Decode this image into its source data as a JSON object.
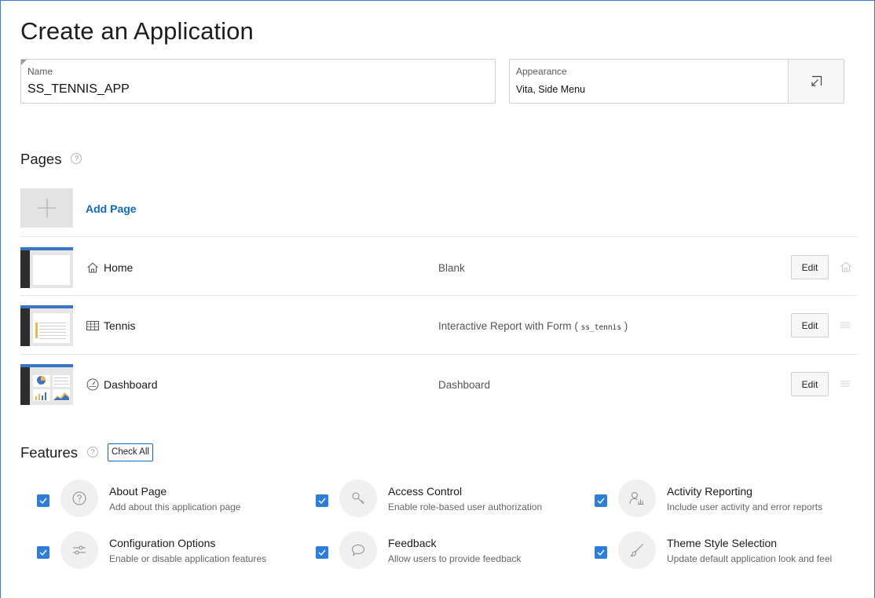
{
  "page": {
    "title": "Create an Application"
  },
  "name_field": {
    "label": "Name",
    "value": "SS_TENNIS_APP"
  },
  "appearance_field": {
    "label": "Appearance",
    "value": "Vita, Side Menu",
    "button_icon": "external-select-icon"
  },
  "pages_section": {
    "title": "Pages",
    "help": "?",
    "add_label": "Add Page",
    "edit_label": "Edit",
    "rows": [
      {
        "name": "Home",
        "icon": "home-icon",
        "type": "Blank",
        "table": "",
        "trail_icon": "home-icon"
      },
      {
        "name": "Tennis",
        "icon": "table-icon",
        "type": "Interactive Report with Form",
        "table": "ss_tennis",
        "trail_icon": "drag-handle-icon"
      },
      {
        "name": "Dashboard",
        "icon": "gauge-icon",
        "type": "Dashboard",
        "table": "",
        "trail_icon": "drag-handle-icon"
      }
    ]
  },
  "features_section": {
    "title": "Features",
    "help": "?",
    "check_all_label": "Check All",
    "items": [
      {
        "title": "About Page",
        "desc": "Add about this application page",
        "icon": "question-icon",
        "checked": true
      },
      {
        "title": "Access Control",
        "desc": "Enable role-based user authorization",
        "icon": "key-icon",
        "checked": true
      },
      {
        "title": "Activity Reporting",
        "desc": "Include user activity and error reports",
        "icon": "user-chart-icon",
        "checked": true
      },
      {
        "title": "Configuration Options",
        "desc": "Enable or disable application features",
        "icon": "sliders-icon",
        "checked": true
      },
      {
        "title": "Feedback",
        "desc": "Allow users to provide feedback",
        "icon": "speech-bubble-icon",
        "checked": true
      },
      {
        "title": "Theme Style Selection",
        "desc": "Update default application look and feel",
        "icon": "brush-icon",
        "checked": true
      }
    ]
  },
  "colors": {
    "accent": "#2d7ed8",
    "link": "#0f6ac4",
    "frame": "#3d7ad6"
  }
}
